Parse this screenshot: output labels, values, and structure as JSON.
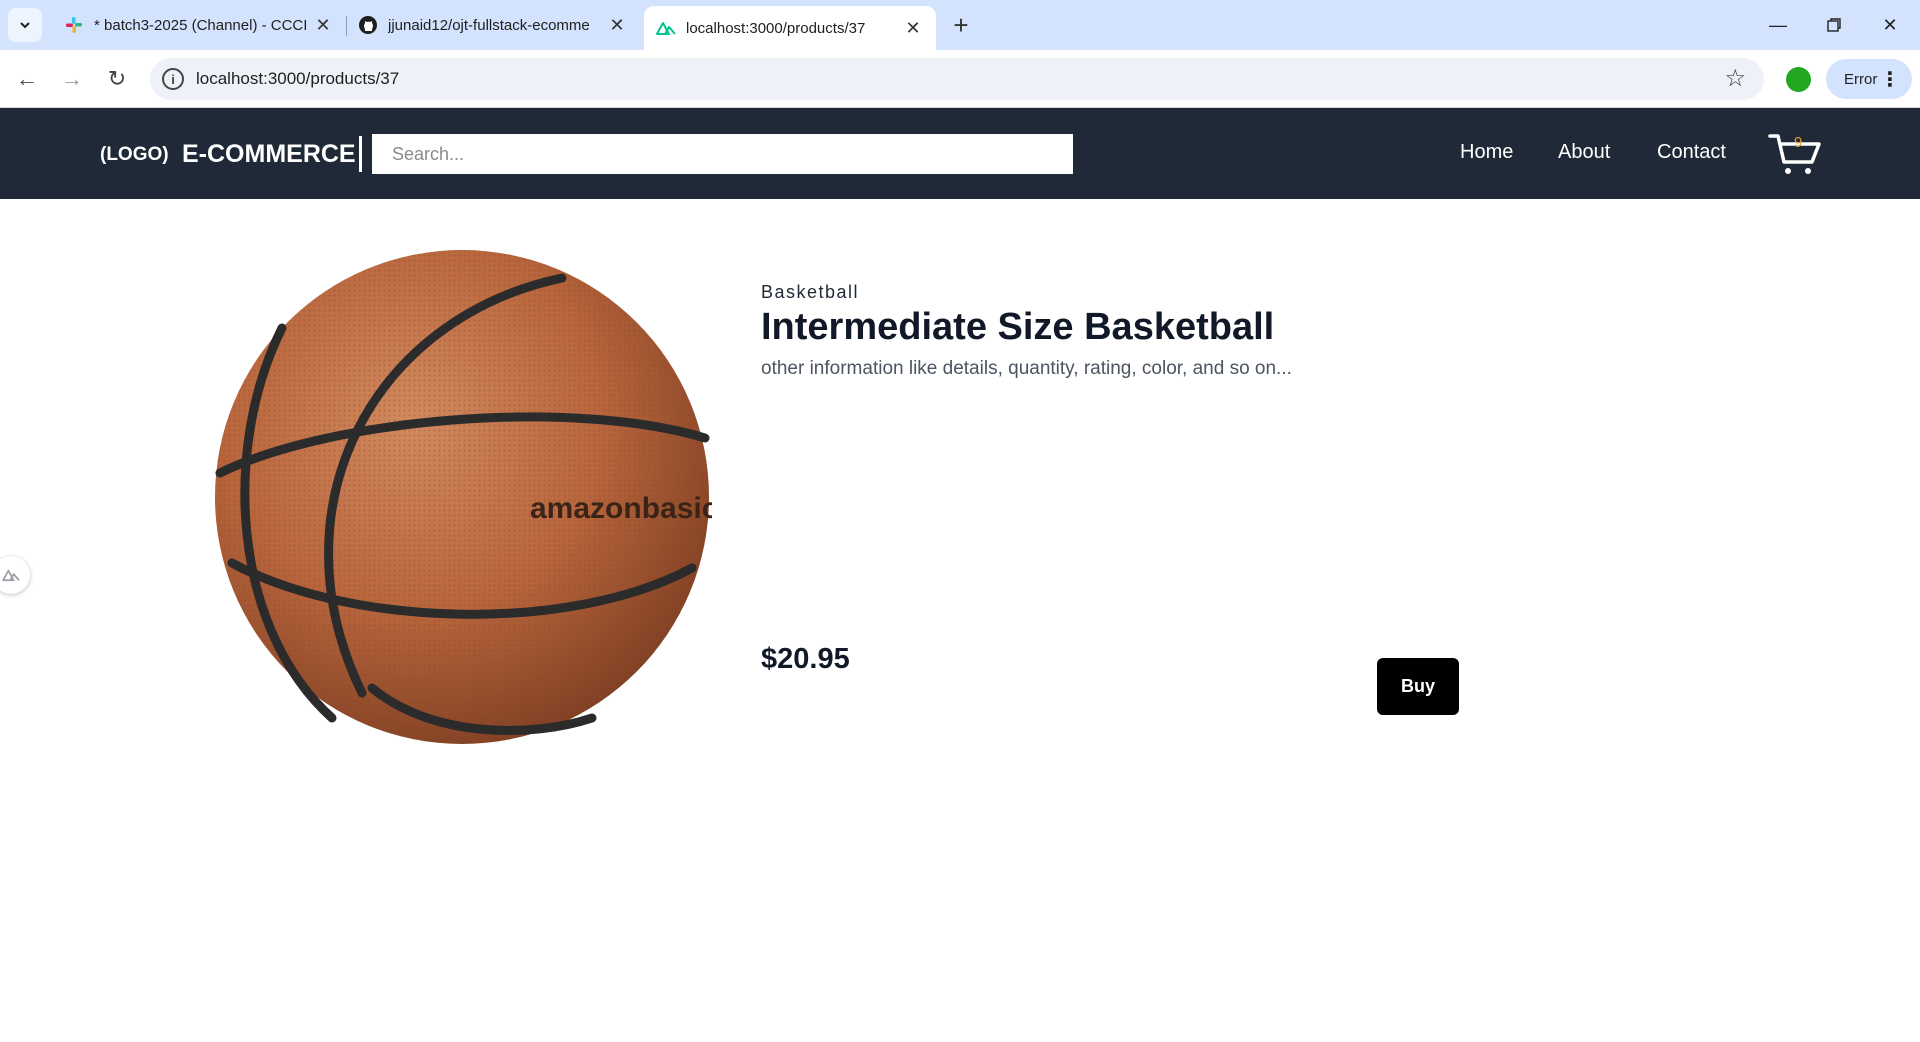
{
  "browser": {
    "tabs": [
      {
        "title": "* batch3-2025 (Channel) - CCCI",
        "icon": "slack-icon"
      },
      {
        "title": "jjunaid12/ojt-fullstack-ecomme",
        "icon": "github-icon"
      },
      {
        "title": "localhost:3000/products/37",
        "icon": "nuxt-icon",
        "active": true
      }
    ],
    "url": "localhost:3000/products/37",
    "profile_label": "Error"
  },
  "header": {
    "logo": "(LOGO)",
    "brand": "E-COMMERCE",
    "search_placeholder": "Search...",
    "nav": [
      "Home",
      "About",
      "Contact"
    ],
    "cart_count": "9",
    "background": "#1f2937"
  },
  "product": {
    "category": "Basketball",
    "name": "Intermediate Size Basketball",
    "description": "other information like details, quantity, rating, color, and so on...",
    "price": "$20.95",
    "buy_label": "Buy",
    "image_brand": "amazonbasics"
  }
}
